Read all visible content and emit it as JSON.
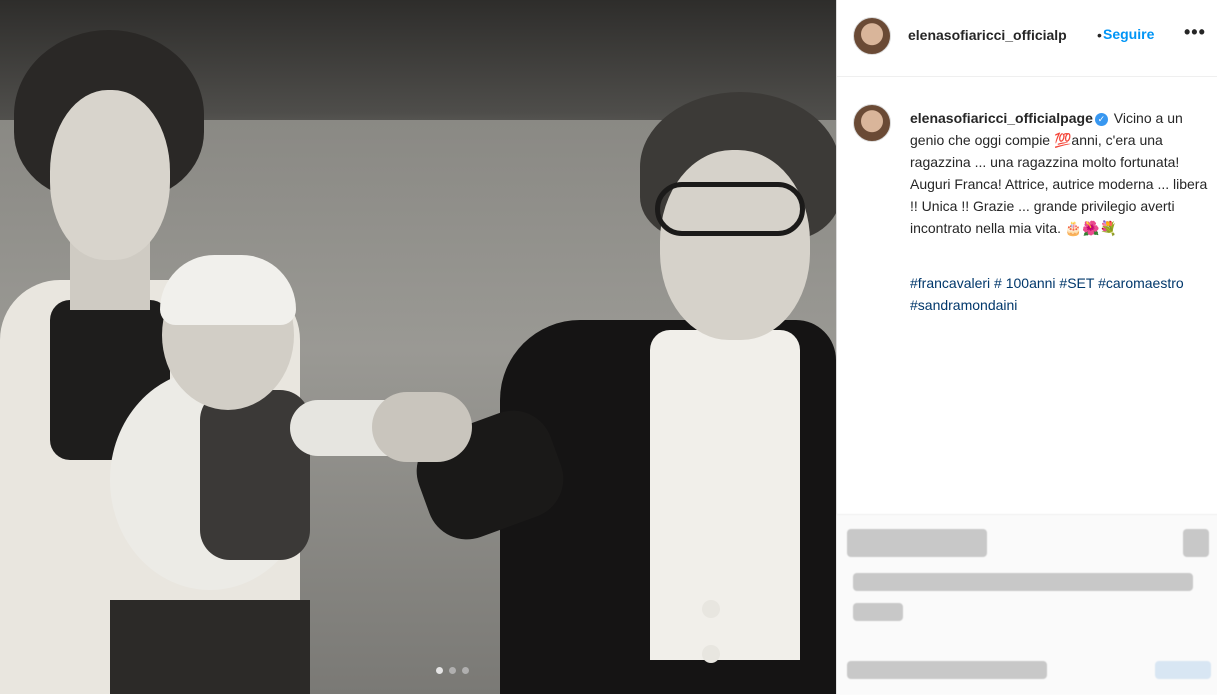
{
  "post": {
    "username": "elenasofiaricci_officialpage",
    "header_username": "elenasofiaricci_officialp",
    "separator": "•",
    "follow_label": "Seguire",
    "more_label": "•••",
    "caption_line1": "Vicino a un genio che oggi compie 💯anni, c'era una ragazzina ... una ragazzina molto fortunata! Auguri Franca! Attrice, autrice moderna ... libera !! Unica !! Grazie ... grande privilegio averti incontrato nella mia vita. 🎂🌺💐",
    "hashtags": "#francavaleri # 100anni #SET #caromaestro #sandramondaini",
    "verified_mark": "✓"
  },
  "carousel": {
    "active_index": 1,
    "total": 3
  },
  "colors": {
    "accent": "#0095f6",
    "text": "#262626",
    "hashtag": "#00376b"
  }
}
